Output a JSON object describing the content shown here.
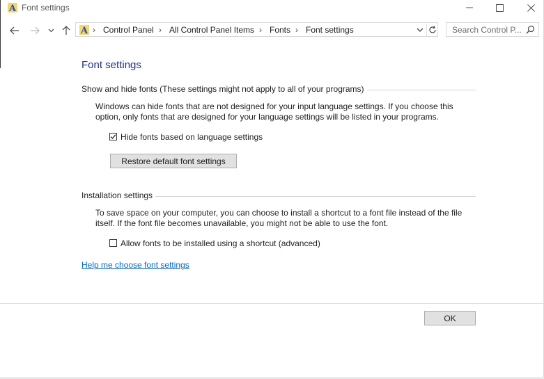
{
  "window": {
    "title": "Font settings",
    "icon": "font-letter-a-icon"
  },
  "nav": {
    "back_icon": "arrow-left-icon",
    "forward_icon": "arrow-right-icon",
    "recent_icon": "chevron-down-icon",
    "up_icon": "arrow-up-icon"
  },
  "address": {
    "crumbs": [
      "Control Panel",
      "All Control Panel Items",
      "Fonts",
      "Font settings"
    ]
  },
  "search": {
    "placeholder": "Search Control P..."
  },
  "page": {
    "heading": "Font settings",
    "show_hide": {
      "title": "Show and hide fonts (These settings might not apply to all of your programs)",
      "description": "Windows can hide fonts that are not designed for your input language settings. If you choose this option, only fonts that are designed for your language settings will be listed in your programs.",
      "checkbox_label": "Hide fonts based on language settings",
      "checkbox_checked": true,
      "restore_button": "Restore default font settings"
    },
    "installation": {
      "title": "Installation settings",
      "description": "To save space on your computer, you can choose to install a shortcut to a font file instead of the file itself. If the font file becomes unavailable, you might not be able to use the font.",
      "checkbox_label": "Allow fonts to be installed using a shortcut (advanced)",
      "checkbox_checked": false
    },
    "help_link": "Help me choose font settings",
    "ok_button": "OK"
  },
  "colors": {
    "heading": "#1e3287",
    "link": "#0066cc",
    "button_bg": "#e1e1e1",
    "icon_yellow": "#f5d76e"
  }
}
